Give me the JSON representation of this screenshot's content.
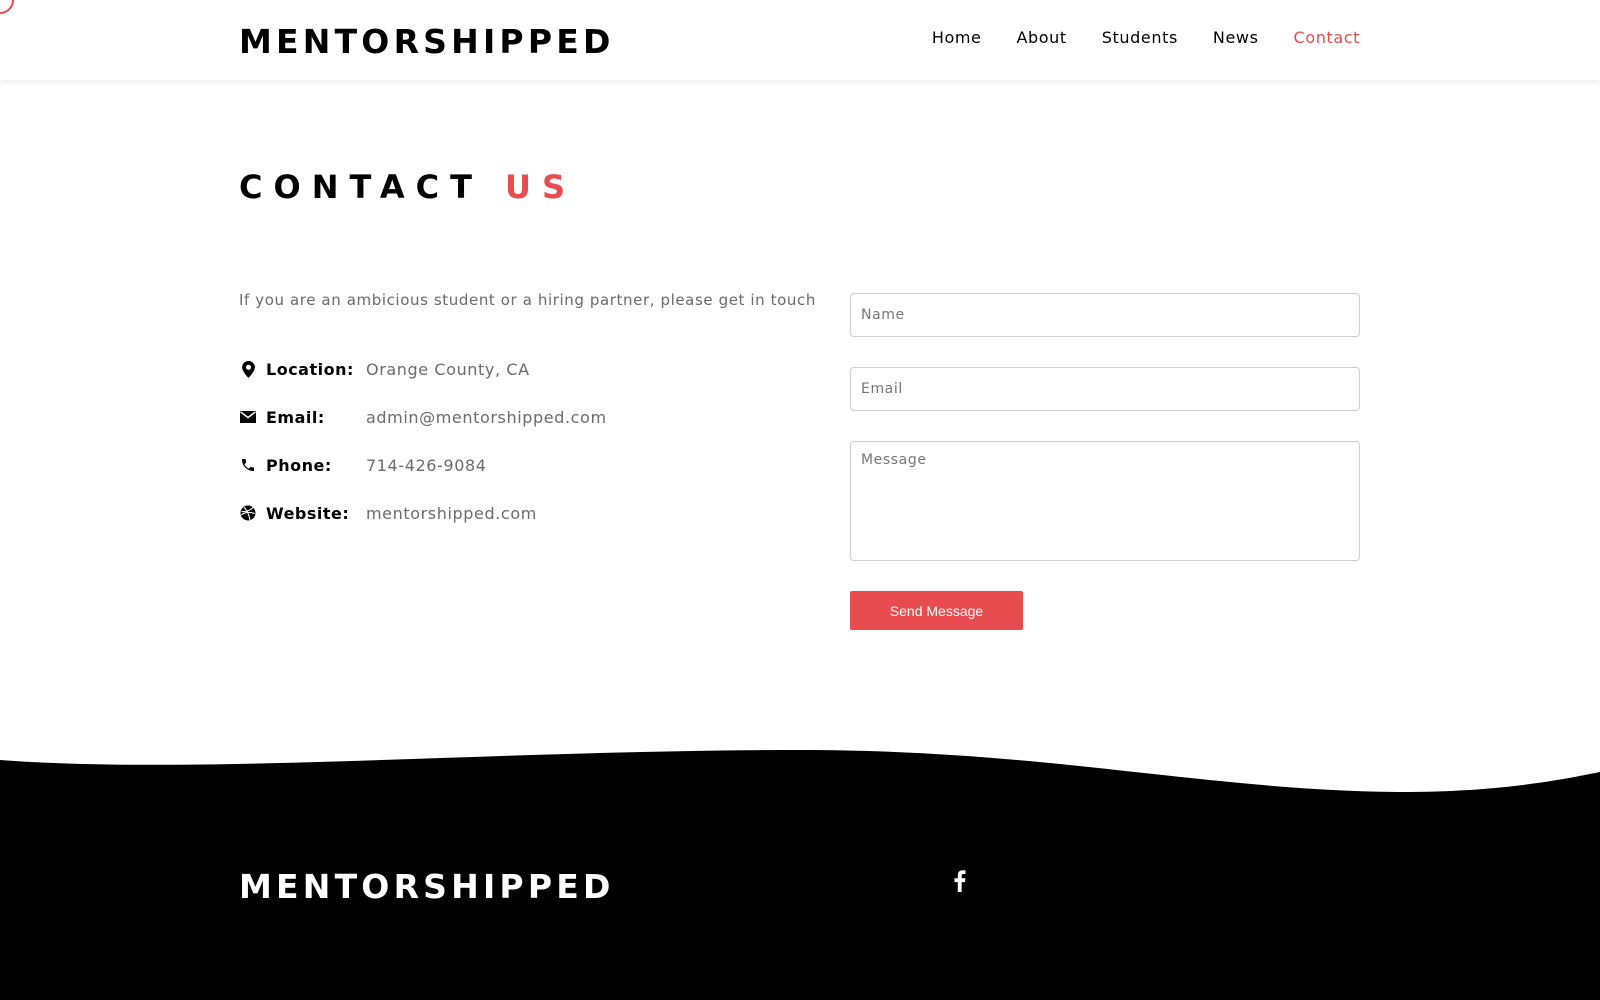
{
  "header": {
    "logo": "MENTORSHIPPED",
    "nav": [
      {
        "label": "Home"
      },
      {
        "label": "About"
      },
      {
        "label": "Students"
      },
      {
        "label": "News"
      },
      {
        "label": "Contact",
        "active": true
      }
    ]
  },
  "main": {
    "title_part1": "CONTACT",
    "title_part2": "US",
    "intro": "If you are an ambicious student or a hiring partner, please get in touch",
    "info": [
      {
        "icon": "map-pin-icon",
        "label": "Location:",
        "value": "Orange County, CA"
      },
      {
        "icon": "envelope-icon",
        "label": "Email:",
        "value": "admin@mentorshipped.com"
      },
      {
        "icon": "phone-icon",
        "label": "Phone:",
        "value": "714-426-9084"
      },
      {
        "icon": "dribbble-icon",
        "label": "Website:",
        "value": "mentorshipped.com"
      }
    ]
  },
  "form": {
    "name_placeholder": "Name",
    "email_placeholder": "Email",
    "message_placeholder": "Message",
    "send_label": "Send Message"
  },
  "footer": {
    "logo": "MENTORSHIPPED",
    "social": [
      "facebook-icon"
    ]
  },
  "colors": {
    "accent": "#e84c4f",
    "text": "#000000",
    "muted": "#6b6b6b",
    "footer_bg": "#000000"
  }
}
